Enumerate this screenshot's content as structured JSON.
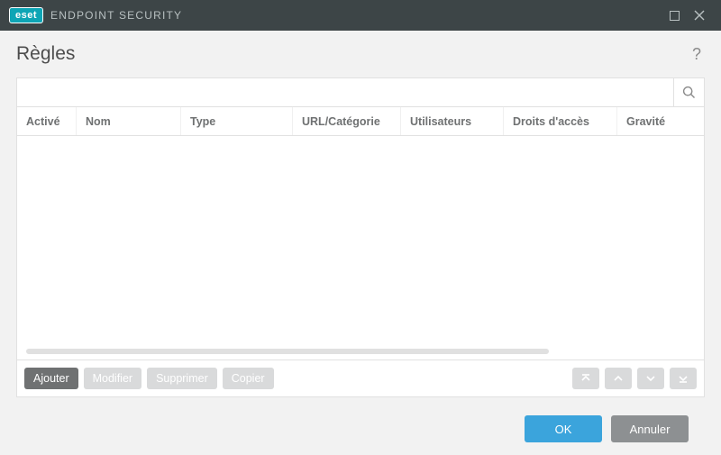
{
  "titlebar": {
    "brand_badge": "eset",
    "brand_text": "ENDPOINT SECURITY"
  },
  "header": {
    "title": "Règles"
  },
  "table": {
    "columns": [
      "Activé",
      "Nom",
      "Type",
      "URL/Catégorie",
      "Utilisateurs",
      "Droits d'accès",
      "Gravité"
    ],
    "rows": []
  },
  "actions": {
    "add": "Ajouter",
    "edit": "Modifier",
    "delete": "Supprimer",
    "copy": "Copier"
  },
  "footer": {
    "ok": "OK",
    "cancel": "Annuler"
  }
}
